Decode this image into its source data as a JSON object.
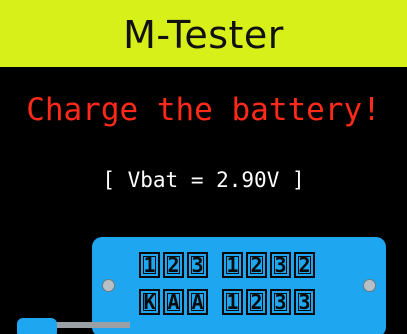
{
  "header": {
    "title": "M-Tester"
  },
  "message": {
    "warning": "Charge the battery!",
    "voltage": "[ Vbat = 2.90V ]"
  },
  "socket": {
    "top_row": [
      "1",
      "2",
      "3",
      "1",
      "2",
      "3",
      "2"
    ],
    "bottom_row": [
      "K",
      "A",
      "A",
      "1",
      "2",
      "3",
      "3"
    ]
  },
  "colors": {
    "title_bar": "#d7f01a",
    "background": "#000000",
    "warning_text": "#ff2a1a",
    "voltage_text": "#ffffff",
    "socket": "#1ea7f0"
  }
}
